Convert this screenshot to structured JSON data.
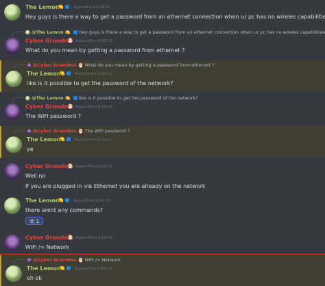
{
  "messages": [
    {
      "author": "The Lemon",
      "badges": "🍋",
      "time": "Aujourd'hui à 08:51",
      "lines": [
        "Hey guys is there a way to get a password from an ethernet connection when ur pc has no wireles capabilities?"
      ]
    },
    {
      "author": "Cyber Grandma",
      "badges": "🎅",
      "time": "Aujourd'hui à 09:11",
      "reply_name": "@The Lemon",
      "reply_text": "Hey guys is there a way to get a password from an ethernet connection when ur pc has no wireles capabilities?",
      "lines": [
        "What do you mean by getting a password from ethernet ?"
      ]
    },
    {
      "author": "The Lemon",
      "badges": "🍋",
      "time": "Aujourd'hui à 09:12",
      "reply_name": "@Cyber Grandma",
      "reply_text": "What do you mean by getting a password from ethernet ?",
      "lines": [
        "like is it possible to get the password of the network?"
      ]
    },
    {
      "author": "Cyber Grandma",
      "badges": "🎅",
      "time": "Aujourd'hui à 09:12",
      "reply_name": "@The Lemon",
      "reply_text": "like is it possible to get the password of the network?",
      "lines": [
        "The WiFi password ?"
      ]
    },
    {
      "author": "The Lemon",
      "badges": "🍋",
      "time": "Aujourd'hui à 09:12",
      "reply_name": "@Cyber Grandma",
      "reply_text": "The WiFi password ?",
      "lines": [
        "ye"
      ]
    },
    {
      "author": "Cyber Grandma",
      "badges": "🎅",
      "time": "Aujourd'hui à 09:13",
      "lines": [
        "Well no",
        "If you are plugged in via Ethernet you are already on the network"
      ]
    },
    {
      "author": "The Lemon",
      "badges": "🍋",
      "time": "Aujourd'hui à 09:13",
      "lines": [
        "there arent any commands?"
      ],
      "reaction": {
        "emoji": "😮",
        "count": "1"
      }
    },
    {
      "author": "Cyber Grandma",
      "badges": "🎅",
      "time": "Aujourd'hui à 09:13",
      "lines": [
        "WiFi /= Network"
      ]
    },
    {
      "author": "The Lemon",
      "badges": "🍋",
      "time": "Aujourd'hui à 09:14",
      "reply_name": "@Cyber Grandma",
      "reply_text": "WiFi /= Network",
      "lines": [
        "oh ok"
      ]
    }
  ]
}
